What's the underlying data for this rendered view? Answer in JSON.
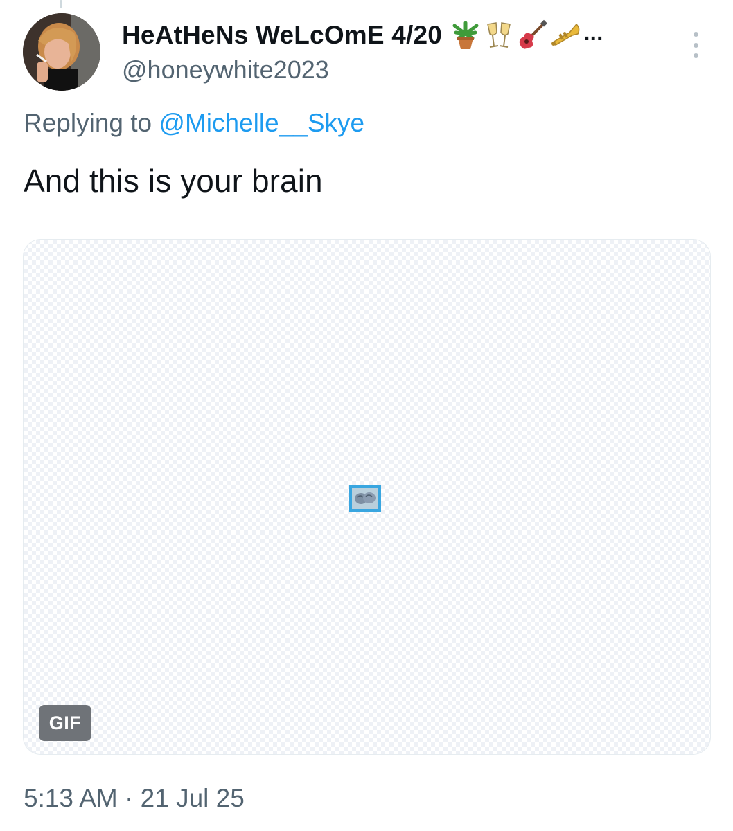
{
  "tweet": {
    "display_name": "HeAtHeNs WeLcOmE 4/20",
    "name_emojis": [
      "potted-plant",
      "clinking-glasses",
      "guitar",
      "trumpet"
    ],
    "name_truncation": "...",
    "handle": "@honeywhite2023",
    "replying_prefix": "Replying to",
    "replying_to": "@Michelle__Skye",
    "text": "And this is your brain",
    "media_badge": "GIF",
    "timestamp": "5:13 AM · 21 Jul 25"
  },
  "colors": {
    "text_primary": "#0f1419",
    "text_secondary": "#536471",
    "link": "#1d9bf0",
    "badge_bg": "#6f7378"
  }
}
